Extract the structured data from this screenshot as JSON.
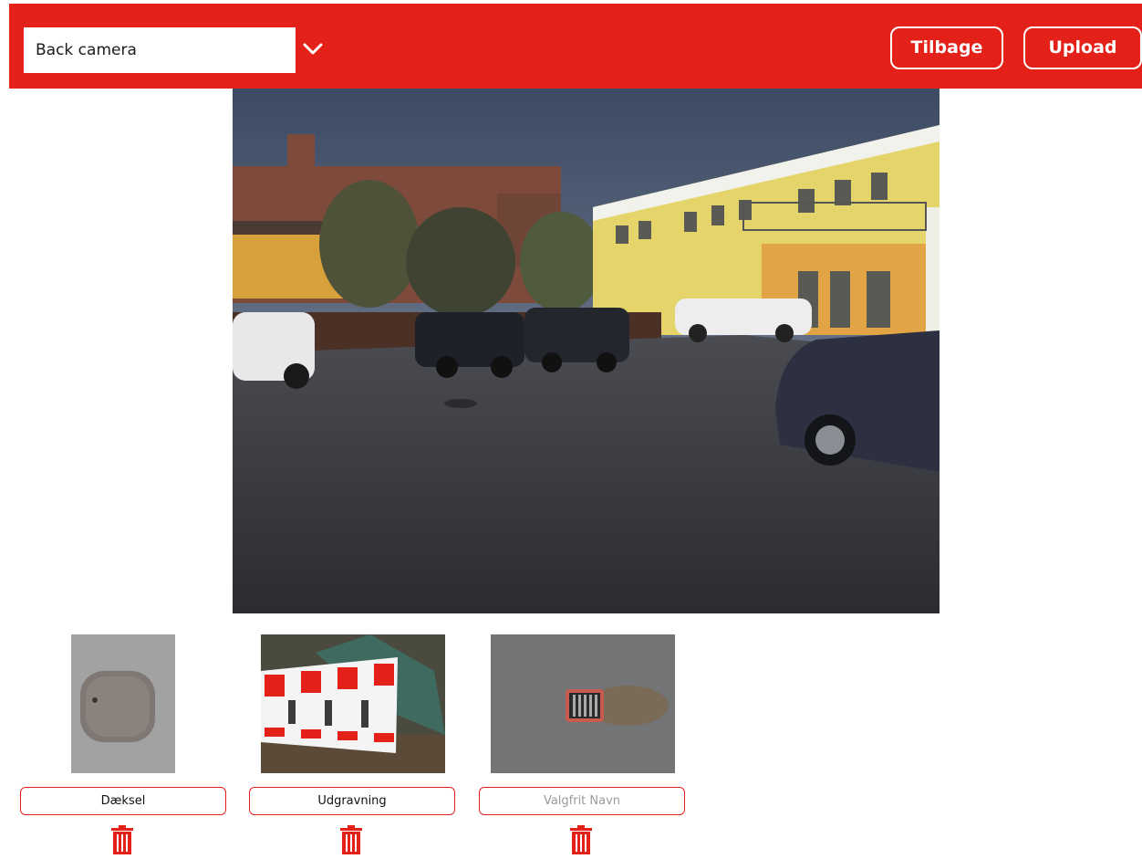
{
  "toolbar": {
    "camera_select": {
      "value": "Back camera",
      "options": [
        "Back camera"
      ]
    },
    "back_label": "Tilbage",
    "upload_label": "Upload"
  },
  "colors": {
    "accent": "#e42118",
    "text_on_accent": "#ffffff"
  },
  "icons": {
    "dropdown": "chevron-down-icon",
    "delete": "trash-icon"
  },
  "photos": [
    {
      "name": "Dæksel",
      "placeholder": ""
    },
    {
      "name": "Udgravning",
      "placeholder": ""
    },
    {
      "name": "",
      "placeholder": "Valgfrit Navn"
    }
  ]
}
